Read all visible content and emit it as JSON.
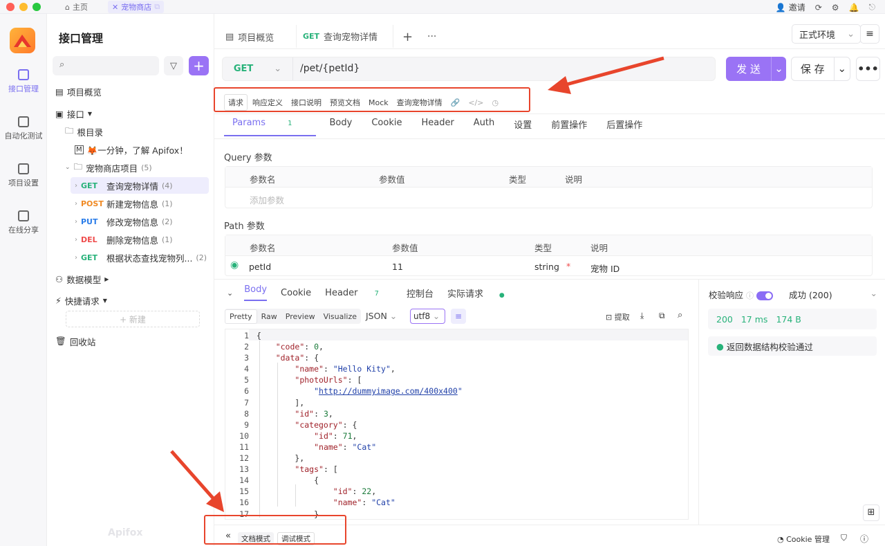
{
  "topbar": {
    "home_tab": "主页",
    "shop_tab": "宠物商店",
    "invite": "邀请"
  },
  "rail": {
    "items": [
      "接口管理",
      "自动化测试",
      "项目设置",
      "在线分享"
    ]
  },
  "tree": {
    "title": "接口管理",
    "overview": "项目概览",
    "api": "接口",
    "root": "根目录",
    "intro": "🦊一分钟，了解 Apifox！",
    "folder": "宠物商店项目",
    "folder_count": "(5)",
    "endpoints": [
      {
        "method": "GET",
        "name": "查询宠物详情",
        "count": "(4)"
      },
      {
        "method": "POST",
        "name": "新建宠物信息",
        "count": "(1)"
      },
      {
        "method": "PUT",
        "name": "修改宠物信息",
        "count": "(2)"
      },
      {
        "method": "DEL",
        "name": "删除宠物信息",
        "count": "(1)"
      },
      {
        "method": "GET",
        "name": "根据状态查找宠物列...",
        "count": "(2)"
      }
    ],
    "models": "数据模型",
    "quick": "快捷请求",
    "new": "+ 新建",
    "trash": "回收站",
    "watermark": "Apifox"
  },
  "main": {
    "tab_overview": "项目概览",
    "tab_method": "GET",
    "tab_detail": "查询宠物详情",
    "env": "正式环境",
    "method": "GET",
    "url": "/pet/{petId}",
    "send": "发 送",
    "save": "保 存",
    "subtabs": [
      "请求",
      "响应定义",
      "接口说明",
      "预览文档",
      "Mock",
      "查询宠物详情"
    ],
    "ptabs": {
      "params": "Params",
      "params_count": "1",
      "body": "Body",
      "cookie": "Cookie",
      "header": "Header",
      "auth": "Auth",
      "settings": "设置",
      "pre": "前置操作",
      "post": "后置操作"
    },
    "query_title": "Query 参数",
    "path_title": "Path 参数",
    "cols": {
      "name": "参数名",
      "value": "参数值",
      "type": "类型",
      "desc": "说明"
    },
    "add_param": "添加参数",
    "path_row": {
      "name": "petId",
      "value": "11",
      "type": "string",
      "required": "*",
      "desc": "宠物 ID"
    }
  },
  "response": {
    "tabs": {
      "body": "Body",
      "cookie": "Cookie",
      "header": "Header",
      "header_count": "7",
      "console": "控制台",
      "actual": "实际请求"
    },
    "formats": [
      "Pretty",
      "Raw",
      "Preview",
      "Visualize"
    ],
    "lang": "JSON",
    "encoding": "utf8",
    "extract": "提取",
    "validate_label": "校验响应",
    "status_select": "成功 (200)",
    "status": "200",
    "time": "17 ms",
    "size": "174 B",
    "valid_msg": "返回数据结构校验通过",
    "line_numbers": [
      "1",
      "2",
      "3",
      "4",
      "5",
      "6",
      "7",
      "8",
      "9",
      "10",
      "11",
      "12",
      "13",
      "14",
      "15",
      "16",
      "17"
    ]
  },
  "bottom": {
    "doc_mode": "文档模式",
    "debug_mode": "调试模式",
    "cookie_mgr": "Cookie 管理"
  },
  "colors": {
    "accent": "#9a73f5",
    "get": "#28b27a",
    "post": "#f08a24",
    "put": "#2b7de9",
    "del": "#ef4b4b",
    "annotation": "#e8452c"
  }
}
